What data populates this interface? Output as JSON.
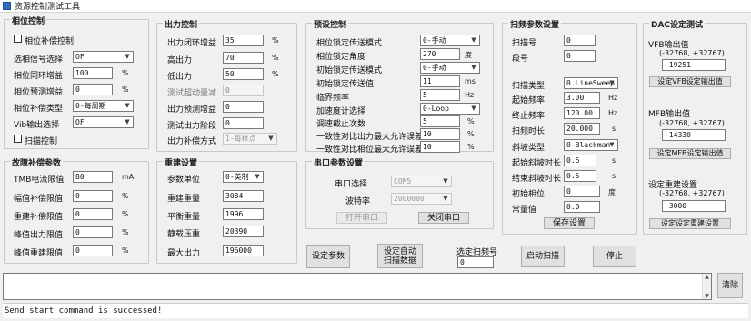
{
  "window": {
    "title": "资源控制测试工具"
  },
  "phase_ctrl": {
    "title": "相位控制",
    "rx_checkbox": "相位补偿控制",
    "rows": [
      {
        "label": "选相信号选择",
        "value": "OF"
      },
      {
        "label": "相位同环增益",
        "value": "100",
        "unit": "%"
      },
      {
        "label": "相位预测增益",
        "value": "0",
        "unit": "%"
      },
      {
        "label": "相位补偿类型",
        "value": "0-每周期"
      },
      {
        "label": "Vib输出选择",
        "value": "OF"
      }
    ],
    "scan_checkbox": "扫描控制"
  },
  "fault": {
    "title": "故障补偿参数",
    "rows": [
      {
        "label": "TMB电流限值",
        "value": "80",
        "unit": "mA"
      },
      {
        "label": "幅值补偿限值",
        "value": "0",
        "unit": "%"
      },
      {
        "label": "重建补偿限值",
        "value": "0",
        "unit": "%"
      },
      {
        "label": "峰值出力限值",
        "value": "0",
        "unit": "%"
      },
      {
        "label": "峰值重建限值",
        "value": "0",
        "unit": "%"
      }
    ]
  },
  "output_ctrl": {
    "title": "出力控制",
    "rows": [
      {
        "label": "出力闭环增益",
        "value": "35",
        "unit": "%",
        "dim": false
      },
      {
        "label": "高出力",
        "value": "70",
        "unit": "%",
        "dim": false
      },
      {
        "label": "低出力",
        "value": "50",
        "unit": "%",
        "dim": false
      },
      {
        "label": "测试超动量减...",
        "value": "0",
        "unit": "",
        "dim": true
      },
      {
        "label": "出力预测增益",
        "value": "0",
        "unit": "",
        "dim": false
      },
      {
        "label": "测试出力阶段",
        "value": "0",
        "unit": "",
        "dim": false
      },
      {
        "label": "出力补偿方式",
        "value": "1-每样点",
        "unit": "",
        "dim": false,
        "combo": true
      }
    ]
  },
  "rebuild": {
    "title": "重建设置",
    "rows": [
      {
        "label": "参数单位",
        "value": "0-英制",
        "combo": true
      },
      {
        "label": "重建重量",
        "value": "3084"
      },
      {
        "label": "平衡重量",
        "value": "1996"
      },
      {
        "label": "静载压重",
        "value": "20390"
      },
      {
        "label": "最大出力",
        "value": "196000"
      }
    ]
  },
  "presync": {
    "title": "预设控制",
    "rows": [
      {
        "label": "相位锁定传送模式",
        "value": "0-手动",
        "combo": true
      },
      {
        "label": "相位锁定角度",
        "value": "270",
        "unit": "度"
      },
      {
        "label": "初始锁定传送模式",
        "value": "0-手动",
        "combo": true
      },
      {
        "label": "初始锁定传送值",
        "value": "11",
        "unit": "ms"
      },
      {
        "label": "临界频率",
        "value": "5",
        "unit": "Hz"
      },
      {
        "label": "加速度计选择",
        "value": "0-Loop",
        "combo": true
      },
      {
        "label": "调速截止次数",
        "value": "5",
        "unit": "%"
      },
      {
        "label": "一致性对比出力最大允许误差",
        "value": "10",
        "unit": "%"
      },
      {
        "label": "一致性对比相位最大允许误差",
        "value": "10",
        "unit": "%"
      }
    ]
  },
  "serial": {
    "title": "串口参数设置",
    "port_label": "串口选择",
    "port_value": "COM5",
    "baud_label": "波特率",
    "baud_value": "2000000",
    "open_btn": "打开串口",
    "close_btn": "关闭串口"
  },
  "sweep": {
    "title": "扫频参数设置",
    "rows": [
      {
        "label": "扫描号",
        "value": "0",
        "unit": ""
      },
      {
        "label": "段号",
        "value": "0",
        "unit": ""
      },
      {
        "label": "扫描类型",
        "value": "0.LineSweep",
        "unit": "",
        "combo": true
      },
      {
        "label": "起始频率",
        "value": "3.00",
        "unit": "Hz"
      },
      {
        "label": "终止频率",
        "value": "120.00",
        "unit": "Hz"
      },
      {
        "label": "扫频时长",
        "value": "20.000",
        "unit": "s"
      },
      {
        "label": "斜坡类型",
        "value": "0-Blackman",
        "unit": "",
        "combo": true
      },
      {
        "label": "起始斜坡时长",
        "value": "0.5",
        "unit": "s"
      },
      {
        "label": "结束斜坡时长",
        "value": "0.5",
        "unit": "s"
      },
      {
        "label": "初始相位",
        "value": "0",
        "unit": "度"
      },
      {
        "label": "常量值",
        "value": "0.0",
        "unit": ""
      }
    ],
    "save_btn": "保存设置"
  },
  "dac": {
    "title": "DAC设定测试",
    "sections": [
      {
        "label": "VFB输出值",
        "range": "(-32768, +32767)",
        "value": "-19251",
        "btn": "设定VFB设定输出值"
      },
      {
        "label": "MFB输出值",
        "range": "(-32768, +32767)",
        "value": "-14330",
        "btn": "设定MFB设定输出值"
      },
      {
        "label": "设定重建设置",
        "range": "(-32768, +32767)",
        "value": "-3000",
        "btn": "设定设定重建设置"
      }
    ]
  },
  "bottom": {
    "set_params": "设定参数",
    "set_auto": "设定自动\n扫描数据",
    "scan_no_label": "选定扫频号",
    "scan_no_value": "0",
    "start_scan": "启动扫描",
    "stop": "停止",
    "clear": "清除"
  },
  "status": {
    "text": "Send start command is successed!"
  }
}
